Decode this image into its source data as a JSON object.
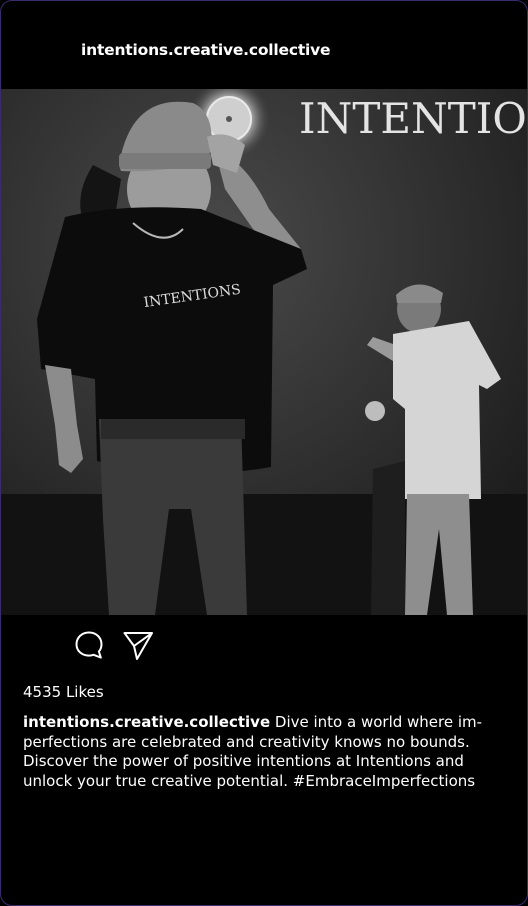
{
  "post": {
    "username": "intentions.creative.collective",
    "image": {
      "banner_text": "INTENTIO",
      "shirt_text": "INTENTIONS"
    },
    "actions": {
      "comment_icon": "comment-bubble-icon",
      "share_icon": "paper-plane-share-icon"
    },
    "likes": "4535 Likes",
    "caption": {
      "author": "intentions.creative.collective",
      "text": "Dive into a world where im-perfections are celebrated and creativity knows no bounds. Discover the power of positive intentions at Intentions and unlock your true creative potential. #EmbraceImperfections"
    }
  },
  "colors": {
    "background": "#000000",
    "text": "#ffffff",
    "border_accent": "#3a2a6e"
  }
}
